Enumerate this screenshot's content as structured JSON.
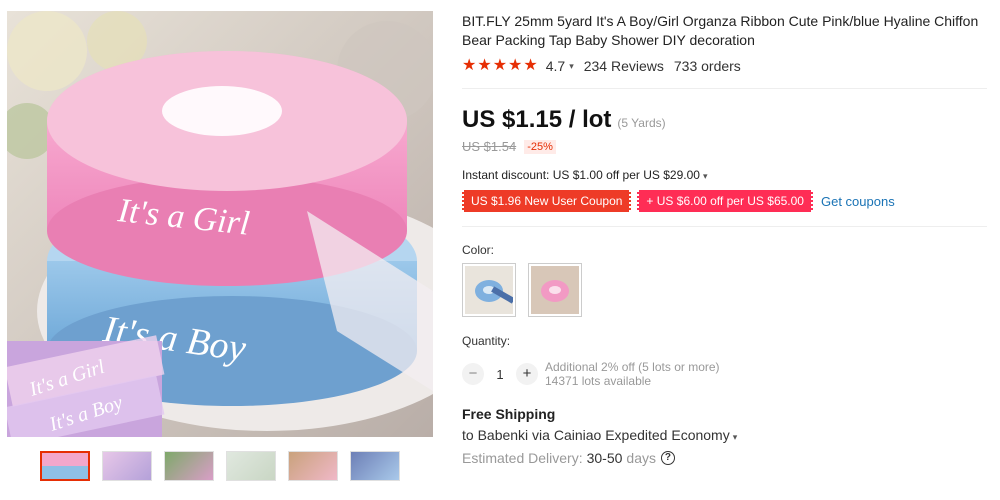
{
  "product": {
    "title": "BIT.FLY 25mm 5yard It's A Boy/Girl Organza Ribbon Cute Pink/blue Hyaline Chiffon Bear Packing Tap Baby Shower DIY decoration",
    "rating": "4.7",
    "reviews": "234 Reviews",
    "orders": "733 orders",
    "stars": 5
  },
  "price": {
    "current": "US $1.15 / lot",
    "unit": "(5 Yards)",
    "original": "US $1.54",
    "discount": "-25%"
  },
  "promotions": {
    "instant_discount": "Instant discount: US $1.00 off per US $29.00",
    "coupon_user": "US $1.96 New User Coupon",
    "coupon_store": "+ US $6.00 off per US $65.00",
    "get_coupons": "Get coupons"
  },
  "color": {
    "label": "Color:",
    "options": [
      "blue",
      "pink"
    ]
  },
  "quantity": {
    "label": "Quantity:",
    "minus": "−",
    "plus": "+",
    "value": "1",
    "note_line1": "Additional 2% off (5 lots or more)",
    "note_line2": "14371 lots available"
  },
  "shipping": {
    "title": "Free Shipping",
    "to": "to Babenki via Cainiao Expedited Economy",
    "delivery_label": "Estimated Delivery:",
    "delivery_value": "30-50",
    "delivery_unit": "days"
  },
  "gallery": {
    "ribbon_text_girl": "It's a Girl",
    "ribbon_text_boy": "It's a Boy",
    "thumbnail_count": 6
  },
  "colors": {
    "accent_red": "#e62e04",
    "coupon_store": "#ff2d55",
    "link_blue": "#1a73b5"
  }
}
